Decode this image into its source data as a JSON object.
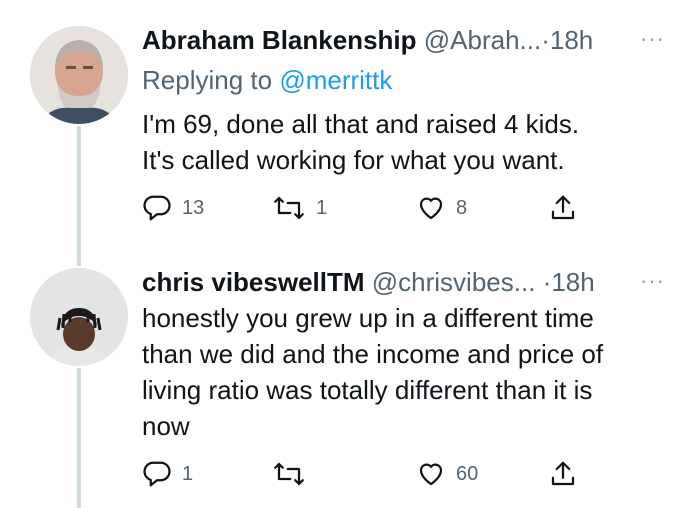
{
  "tweets": [
    {
      "name": "Abraham Blankenship",
      "handle": "@Abrah...",
      "dot": "·",
      "time": "18h",
      "more": "···",
      "reply_prefix": "Replying to ",
      "reply_to": "@merrittk",
      "text_lines": [
        "I'm  69, done all that and raised  4 kids.",
        "It's called  working for  what you want."
      ],
      "replies": "13",
      "retweets": "1",
      "likes": "8"
    },
    {
      "name": "chris vibeswell",
      "badge": "TM",
      "handle": "@chrisvibes...",
      "dot": "·",
      "time": "18h",
      "more": "···",
      "text_lines": [
        "honestly you grew up in a different time",
        "than we did and the income and price of",
        "living ratio was totally different than it is",
        "now"
      ],
      "replies": "1",
      "retweets": "",
      "likes": "60"
    }
  ],
  "icons": {
    "reply": "reply-icon",
    "retweet": "retweet-icon",
    "like": "heart-icon",
    "share": "share-icon",
    "more": "more-icon"
  },
  "colors": {
    "text": "#0f1419",
    "secondary": "#536471",
    "link": "#1d9bf0",
    "thread_line": "#cfd9de"
  }
}
